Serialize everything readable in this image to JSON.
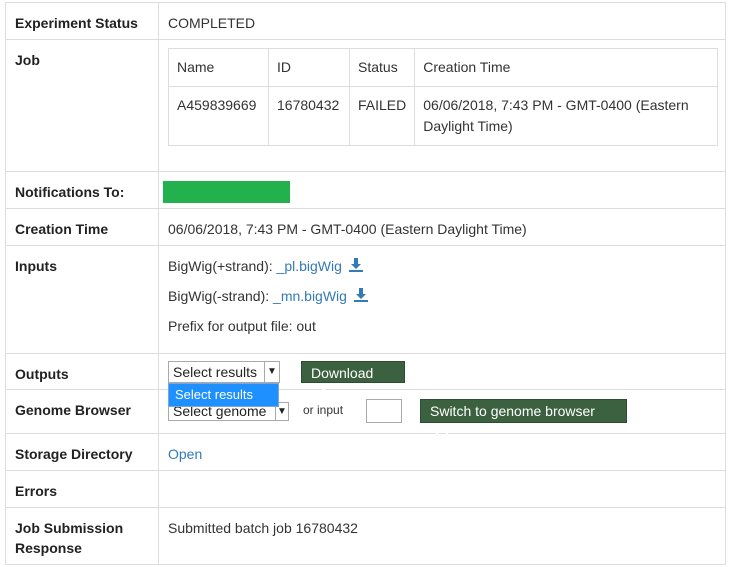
{
  "rows": {
    "status": {
      "label": "Experiment Status",
      "value": "COMPLETED"
    },
    "job": {
      "label": "Job",
      "headers": [
        "Name",
        "ID",
        "Status",
        "Creation Time"
      ],
      "row": {
        "name": "A459839669",
        "id": "16780432",
        "status": "FAILED",
        "creation_time": "06/06/2018, 7:43 PM - GMT-0400 (Eastern Daylight Time)"
      }
    },
    "notifications": {
      "label": "Notifications To:",
      "redaction_color": "#22b14c"
    },
    "creation_time": {
      "label": "Creation Time",
      "value": "06/06/2018, 7:43 PM - GMT-0400 (Eastern Daylight Time)"
    },
    "inputs": {
      "label": "Inputs",
      "plus_prefix": "BigWig(+strand):",
      "plus_link": "_pl.bigWig",
      "minus_prefix": "BigWig(-strand):",
      "minus_link": "_mn.bigWig",
      "prefix_text": "Prefix for output file: out"
    },
    "outputs": {
      "label": "Outputs",
      "select_value": "Select results",
      "dropdown_option": "Select results",
      "download_label": "Download"
    },
    "genome_browser": {
      "label": "Genome Browser",
      "select_value": "Select genome",
      "or_input": "or input",
      "input_value": "",
      "switch_label": "Switch to genome browser"
    },
    "storage": {
      "label": "Storage Directory",
      "link": "Open"
    },
    "errors": {
      "label": "Errors",
      "value": ""
    },
    "submission": {
      "label": "Job Submission Response",
      "value": "Submitted batch job 16780432"
    }
  },
  "colors": {
    "link": "#337ab7",
    "button_bg": "#3c6140",
    "dropdown_highlight": "#1e90ff",
    "border": "#dddddd"
  }
}
